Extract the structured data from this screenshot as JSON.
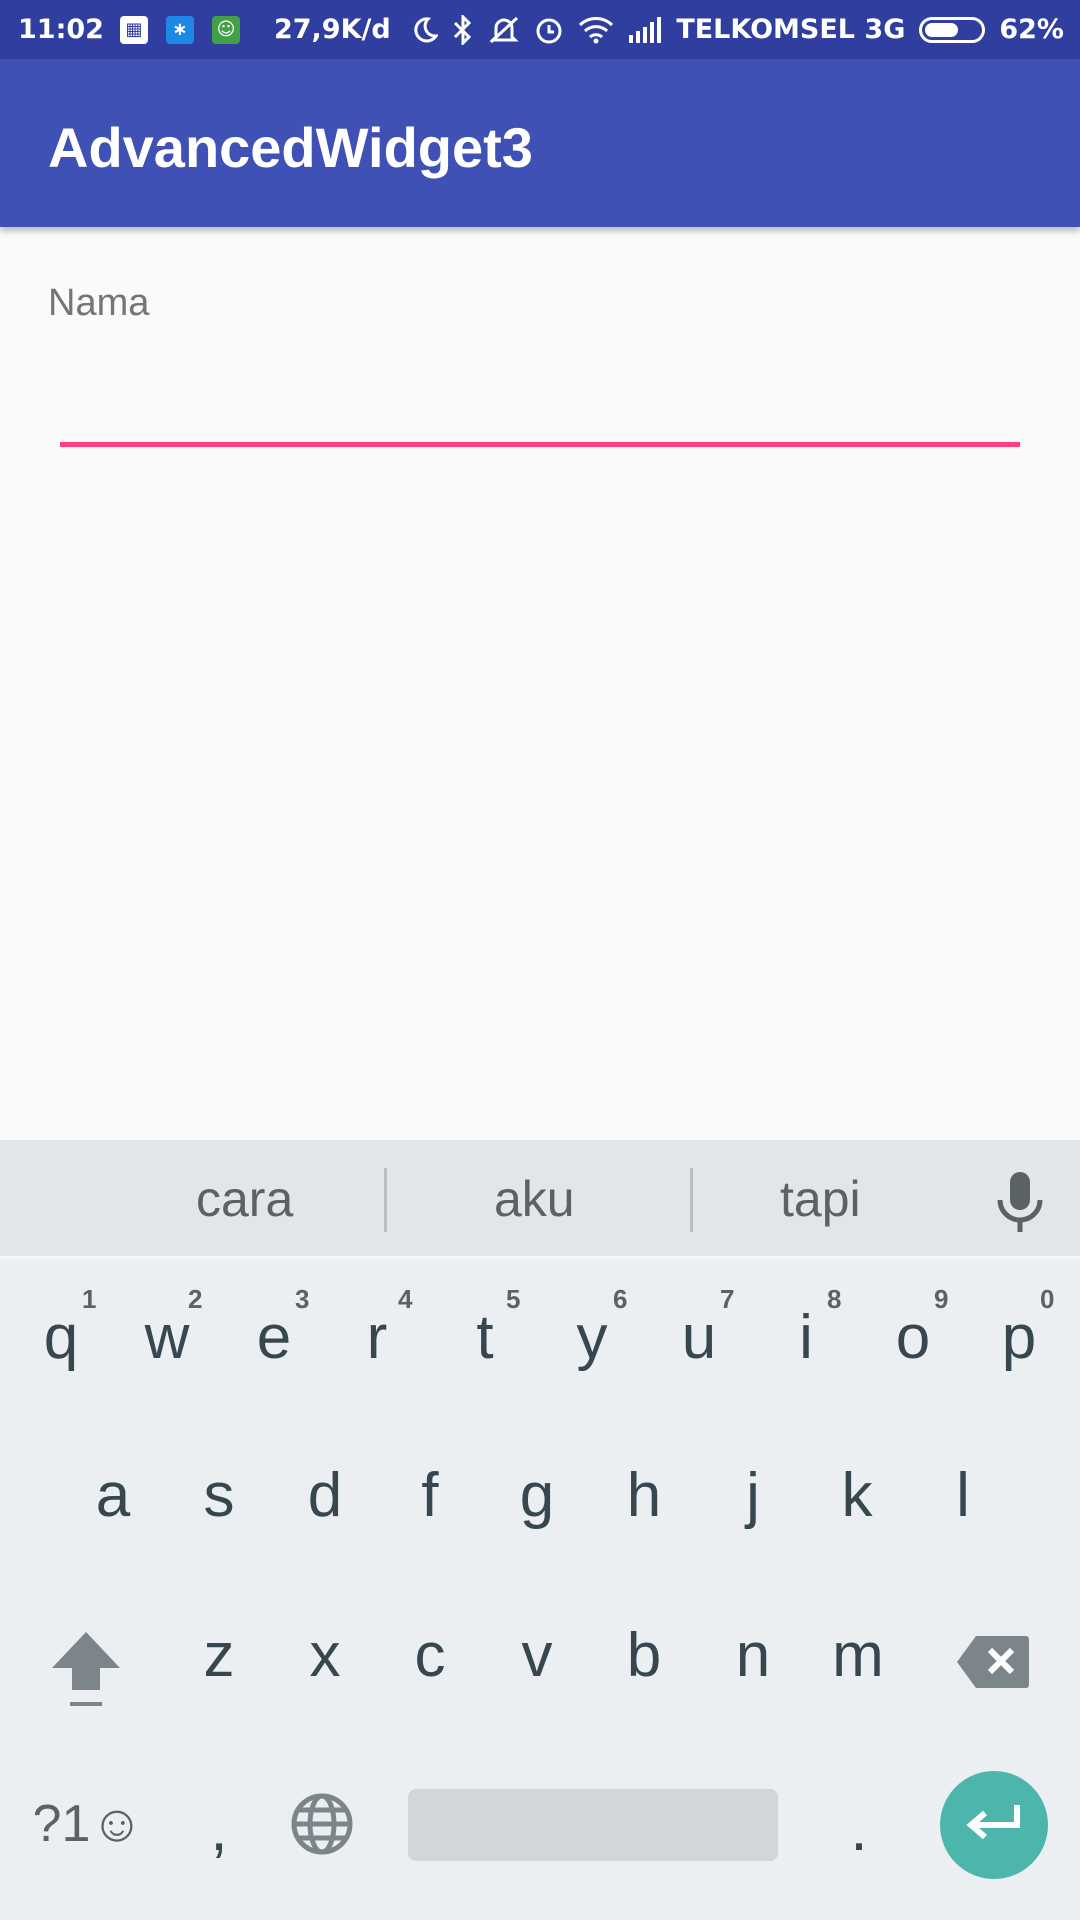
{
  "status_bar": {
    "time": "11:02",
    "speed": "27,9K/d",
    "carrier": "TELKOMSEL 3G",
    "battery_percent": "62%",
    "battery_level": 0.62,
    "icons": [
      "bbm-icon",
      "bluetooth-app-icon",
      "android-app-icon",
      "moon-icon",
      "bluetooth-icon",
      "silent-icon",
      "alarm-icon",
      "wifi-icon",
      "signal-icon",
      "battery-icon"
    ]
  },
  "app_bar": {
    "title": "AdvancedWidget3",
    "color": "#3f51b5"
  },
  "form": {
    "label": "Nama",
    "value": "",
    "accent": "#ff4081"
  },
  "keyboard": {
    "suggestions": [
      "cara",
      "aku",
      "tapi"
    ],
    "row1": [
      "q",
      "w",
      "e",
      "r",
      "t",
      "y",
      "u",
      "i",
      "o",
      "p"
    ],
    "row1_hints": [
      "1",
      "2",
      "3",
      "4",
      "5",
      "6",
      "7",
      "8",
      "9",
      "0"
    ],
    "row2": [
      "a",
      "s",
      "d",
      "f",
      "g",
      "h",
      "j",
      "k",
      "l"
    ],
    "row3": [
      "z",
      "x",
      "c",
      "v",
      "b",
      "n",
      "m"
    ],
    "symbols_label": "?1☺",
    "comma": ",",
    "period": ".",
    "enter_color": "#4db6ac"
  }
}
